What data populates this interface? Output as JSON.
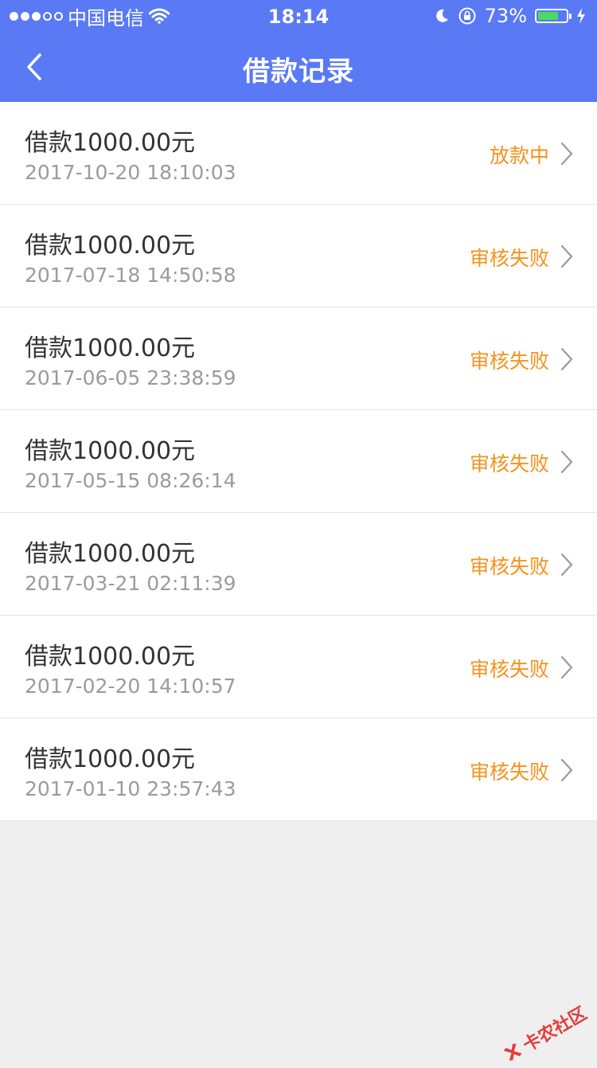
{
  "status_bar": {
    "carrier": "中国电信",
    "time": "18:14",
    "battery_percent": "73%",
    "battery_level": 0.73
  },
  "nav": {
    "title": "借款记录",
    "back_icon": "chevron-left-icon"
  },
  "records": [
    {
      "title": "借款1000.00元",
      "time": "2017-10-20 18:10:03",
      "status": "放款中"
    },
    {
      "title": "借款1000.00元",
      "time": "2017-07-18 14:50:58",
      "status": "审核失败"
    },
    {
      "title": "借款1000.00元",
      "time": "2017-06-05 23:38:59",
      "status": "审核失败"
    },
    {
      "title": "借款1000.00元",
      "time": "2017-05-15 08:26:14",
      "status": "审核失败"
    },
    {
      "title": "借款1000.00元",
      "time": "2017-03-21 02:11:39",
      "status": "审核失败"
    },
    {
      "title": "借款1000.00元",
      "time": "2017-02-20 14:10:57",
      "status": "审核失败"
    },
    {
      "title": "借款1000.00元",
      "time": "2017-01-10 23:57:43",
      "status": "审核失败"
    }
  ],
  "watermark": {
    "text": "卡农社区"
  },
  "colors": {
    "header": "#5a79f4",
    "status": "#f5921c",
    "time": "#9b9b9b",
    "background": "#efefef"
  }
}
